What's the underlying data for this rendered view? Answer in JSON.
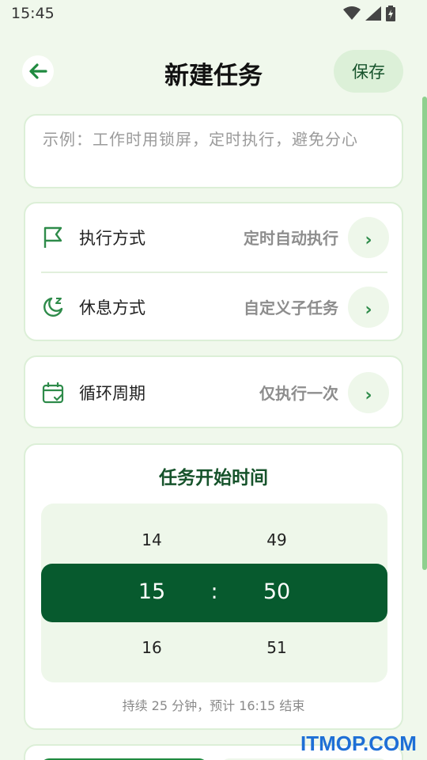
{
  "status": {
    "time": "15:45"
  },
  "header": {
    "title": "新建任务",
    "save_label": "保存"
  },
  "note": {
    "placeholder": "示例：工作时用锁屏，定时执行，避免分心"
  },
  "settings": {
    "execution_label": "执行方式",
    "execution_value": "定时自动执行",
    "rest_label": "休息方式",
    "rest_value": "自定义子任务",
    "cycle_label": "循环周期",
    "cycle_value": "仅执行一次",
    "chevron": "›"
  },
  "time_picker": {
    "title": "任务开始时间",
    "hours": {
      "prev": "14",
      "selected": "15",
      "next": "16"
    },
    "minutes": {
      "prev": "49",
      "selected": "50",
      "next": "51"
    },
    "separator": ":",
    "summary": "持续 25 分钟，预计 16:15 结束"
  },
  "watermark": "ITMOP.COM",
  "colors": {
    "background": "#f0f8ec",
    "accent_dark": "#075a2e",
    "accent": "#2e8b4a",
    "pill_bg": "#dcf0d8"
  },
  "icons": {
    "back": "arrow-left-icon",
    "execution": "flag-icon",
    "rest": "moon-sleep-icon",
    "cycle": "calendar-check-icon"
  }
}
